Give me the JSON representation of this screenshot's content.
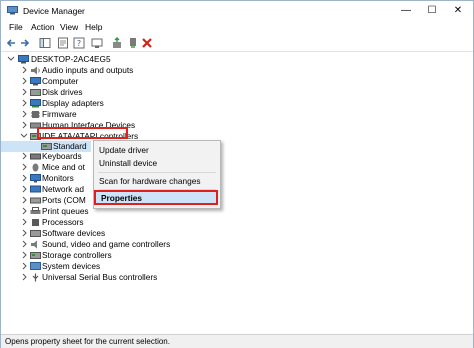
{
  "window": {
    "title": "Device Manager"
  },
  "menubar": {
    "items": [
      "File",
      "Action",
      "View",
      "Help"
    ]
  },
  "tree": {
    "root": "DESKTOP-2AC4EG5",
    "items": [
      "Audio inputs and outputs",
      "Computer",
      "Disk drives",
      "Display adapters",
      "Firmware",
      "Human Interface Devices",
      "IDE ATA/ATAPI controllers",
      "Standard",
      "Keyboards",
      "Mice and ot",
      "Monitors",
      "Network ad",
      "Ports (COM",
      "Print queues",
      "Processors",
      "Software devices",
      "Sound, video and game controllers",
      "Storage controllers",
      "System devices",
      "Universal Serial Bus controllers"
    ]
  },
  "context_menu": {
    "items": [
      "Update driver",
      "Uninstall device",
      "Scan for hardware changes",
      "Properties"
    ]
  },
  "statusbar": {
    "text": "Opens property sheet for the current selection."
  },
  "colors": {
    "highlight_border": "#e0201a",
    "selection": "#cde3f7"
  }
}
